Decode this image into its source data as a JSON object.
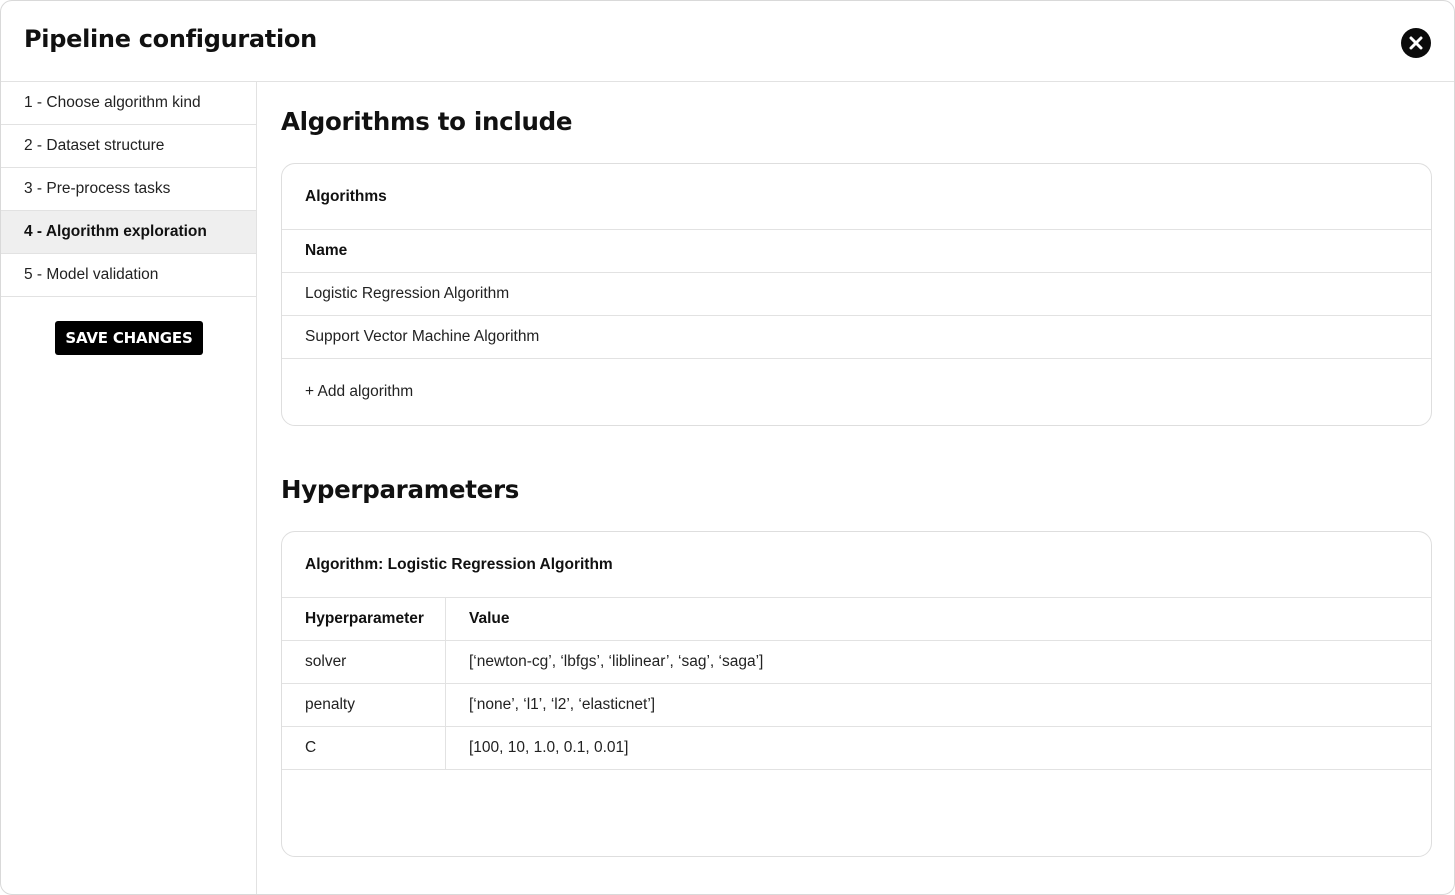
{
  "window": {
    "title": "Pipeline configuration"
  },
  "icons": {
    "close": "close-icon"
  },
  "sidebar": {
    "items": [
      {
        "label": "1 - Choose algorithm kind"
      },
      {
        "label": "2 - Dataset structure"
      },
      {
        "label": "3 - Pre-process tasks"
      },
      {
        "label": "4 - Algorithm exploration",
        "active": true
      },
      {
        "label": "5 - Model validation"
      }
    ],
    "save_label": "SAVE CHANGES"
  },
  "algorithms_section": {
    "title": "Algorithms to include",
    "card_title": "Algorithms",
    "column_header": "Name",
    "rows": [
      "Logistic Regression Algorithm",
      "Support Vector Machine Algorithm"
    ],
    "add_label": "+ Add algorithm"
  },
  "hyperparameters_section": {
    "title": "Hyperparameters",
    "card_title": "Algorithm: Logistic Regression Algorithm",
    "columns": [
      "Hyperparameter",
      "Value"
    ],
    "rows": [
      {
        "name": "solver",
        "value": "[‘newton-cg’, ‘lbfgs’, ‘liblinear’, ‘sag’, ‘saga’]"
      },
      {
        "name": "penalty",
        "value": "[‘none’, ‘l1’, ‘l2’, ‘elasticnet’]"
      },
      {
        "name": "C",
        "value": "[100, 10, 1.0, 0.1, 0.01]"
      }
    ]
  },
  "colors": {
    "accent": "#000000",
    "active_item_bg": "#efefef",
    "border": "#e2e2e2"
  }
}
